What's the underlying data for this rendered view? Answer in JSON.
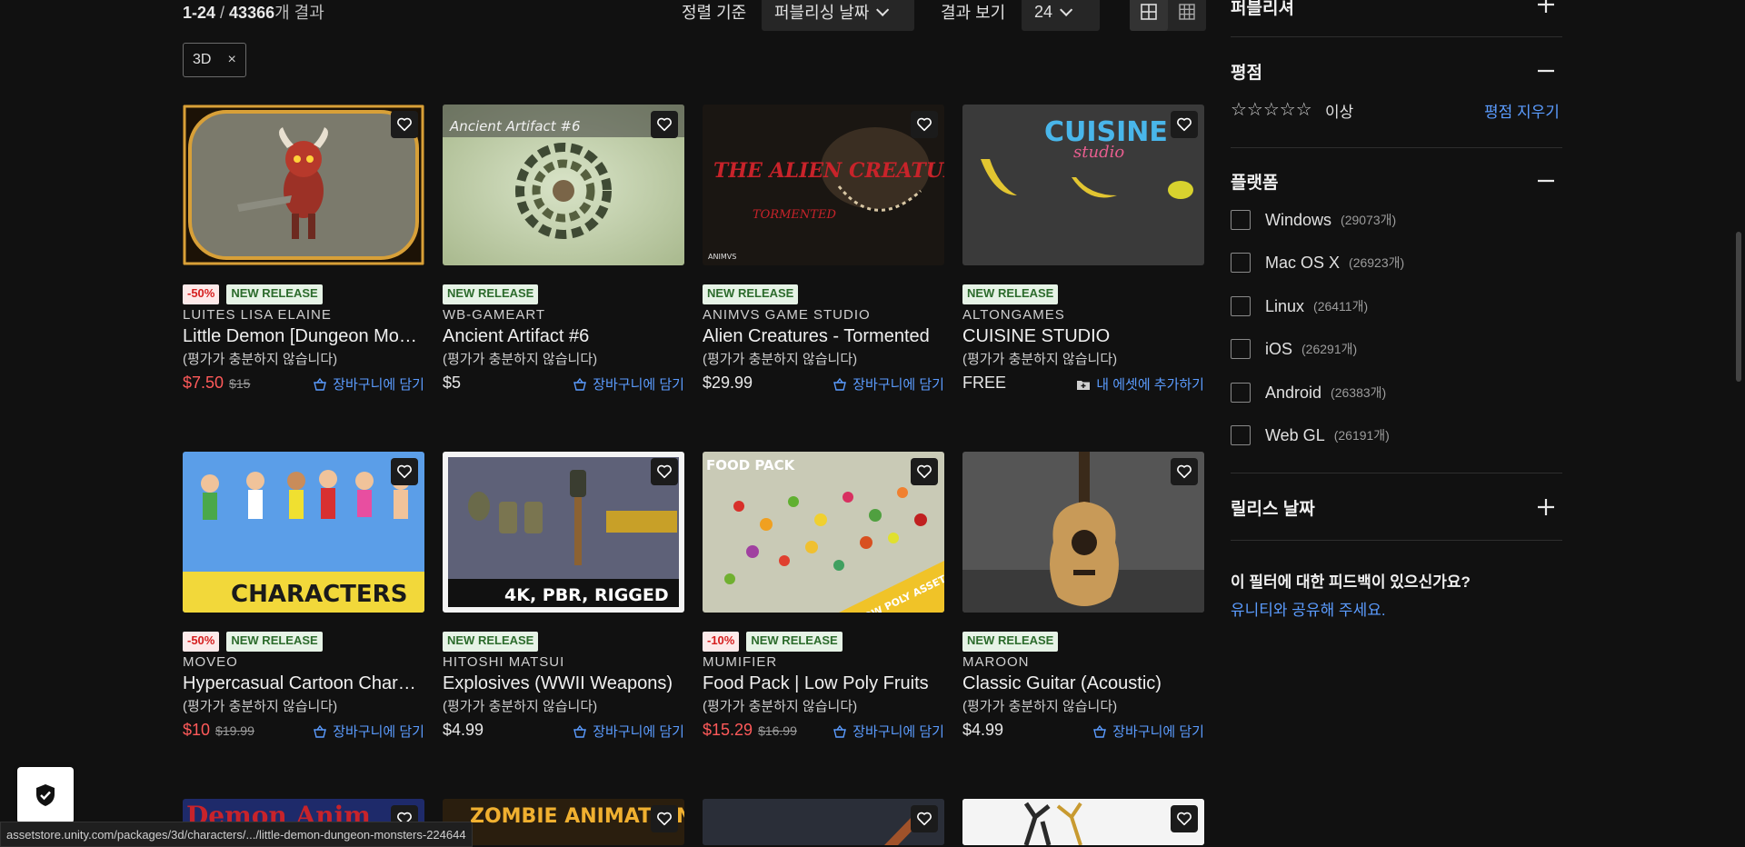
{
  "toolbar": {
    "range": "1-24",
    "separator": " / ",
    "total": "43366",
    "suffix": "개 결과",
    "sort_label": "정렬 기준",
    "sort_value": "퍼블리싱 날짜",
    "view_label": "결과 보기",
    "per_page_value": "24"
  },
  "active_filter": {
    "label": "3D",
    "remove": "×"
  },
  "products_row1": [
    {
      "badges": [
        "-50%",
        "NEW RELEASE"
      ],
      "publisher": "LUITES LISA ELAINE",
      "title": "Little Demon [Dungeon Monsters]",
      "rating": "(평가가 충분하지 않습니다)",
      "price": "$7.50",
      "old_price": "$15",
      "sale": true,
      "action": "장바구니에 담기"
    },
    {
      "badges": [
        "NEW RELEASE"
      ],
      "publisher": "WB-GAMEART",
      "title": "Ancient Artifact #6",
      "rating": "(평가가 충분하지 않습니다)",
      "price": "$5",
      "old_price": "",
      "sale": false,
      "action": "장바구니에 담기"
    },
    {
      "badges": [
        "NEW RELEASE"
      ],
      "publisher": "ANIMVS GAME STUDIO",
      "title": "Alien Creatures - Tormented",
      "rating": "(평가가 충분하지 않습니다)",
      "price": "$29.99",
      "old_price": "",
      "sale": false,
      "action": "장바구니에 담기"
    },
    {
      "badges": [
        "NEW RELEASE"
      ],
      "publisher": "ALTONGAMES",
      "title": "CUISINE STUDIO",
      "rating": "(평가가 충분하지 않습니다)",
      "price": "FREE",
      "old_price": "",
      "sale": false,
      "action": "내 에셋에 추가하기"
    }
  ],
  "products_row2": [
    {
      "badges": [
        "-50%",
        "NEW RELEASE"
      ],
      "publisher": "MOVEO",
      "title": "Hypercasual Cartoon Characters",
      "rating": "(평가가 충분하지 않습니다)",
      "price": "$10",
      "old_price": "$19.99",
      "sale": true,
      "action": "장바구니에 담기"
    },
    {
      "badges": [
        "NEW RELEASE"
      ],
      "publisher": "HITOSHI MATSUI",
      "title": "Explosives (WWII Weapons)",
      "rating": "(평가가 충분하지 않습니다)",
      "price": "$4.99",
      "old_price": "",
      "sale": false,
      "action": "장바구니에 담기"
    },
    {
      "badges": [
        "-10%",
        "NEW RELEASE"
      ],
      "publisher": "MUMIFIER",
      "title": "Food Pack | Low Poly Fruits",
      "rating": "(평가가 충분하지 않습니다)",
      "price": "$15.29",
      "old_price": "$16.99",
      "sale": true,
      "action": "장바구니에 담기"
    },
    {
      "badges": [
        "NEW RELEASE"
      ],
      "publisher": "MAROON",
      "title": "Classic Guitar (Acoustic)",
      "rating": "(평가가 충분하지 않습니다)",
      "price": "$4.99",
      "old_price": "",
      "sale": false,
      "action": "장바구니에 담기"
    }
  ],
  "thumb_text": {
    "artifact": "Ancient Artifact #6",
    "alien": "THE ALIEN CREATURES",
    "alien_sub": "TORMENTED",
    "alien_logo": "ANIMVS",
    "cuisine": "CUISINE",
    "cuisine_sub": "studio",
    "characters": "CHARACTERS",
    "explosives": "4K, PBR, RIGGED",
    "food": "FOOD PACK",
    "food_sub": "LOW POLY ASSETS",
    "row3_a": "Demon Anim",
    "row3_b": "ZOMBIE ANIMATIONS"
  },
  "sidebar": {
    "publisher_title": "퍼블리셔",
    "rating_title": "평점",
    "rating_stars": "☆☆☆☆☆",
    "rating_suffix": "이상",
    "rating_clear": "평점 지우기",
    "platform_title": "플랫폼",
    "platforms": [
      {
        "name": "Windows",
        "count": "(29073개)"
      },
      {
        "name": "Mac OS X",
        "count": "(26923개)"
      },
      {
        "name": "Linux",
        "count": "(26411개)"
      },
      {
        "name": "iOS",
        "count": "(26291개)"
      },
      {
        "name": "Android",
        "count": "(26383개)"
      },
      {
        "name": "Web GL",
        "count": "(26191개)"
      }
    ],
    "release_title": "릴리스 날짜",
    "feedback_question": "이 필터에 대한 피드백이 있으신가요?",
    "feedback_link": "유니티와 공유해 주세요."
  },
  "status_url": "assetstore.unity.com/packages/3d/characters/.../little-demon-dungeon-monsters-224644",
  "colors": {
    "accent": "#5b9cff",
    "sale": "#ff5a5a",
    "background": "#111111"
  }
}
